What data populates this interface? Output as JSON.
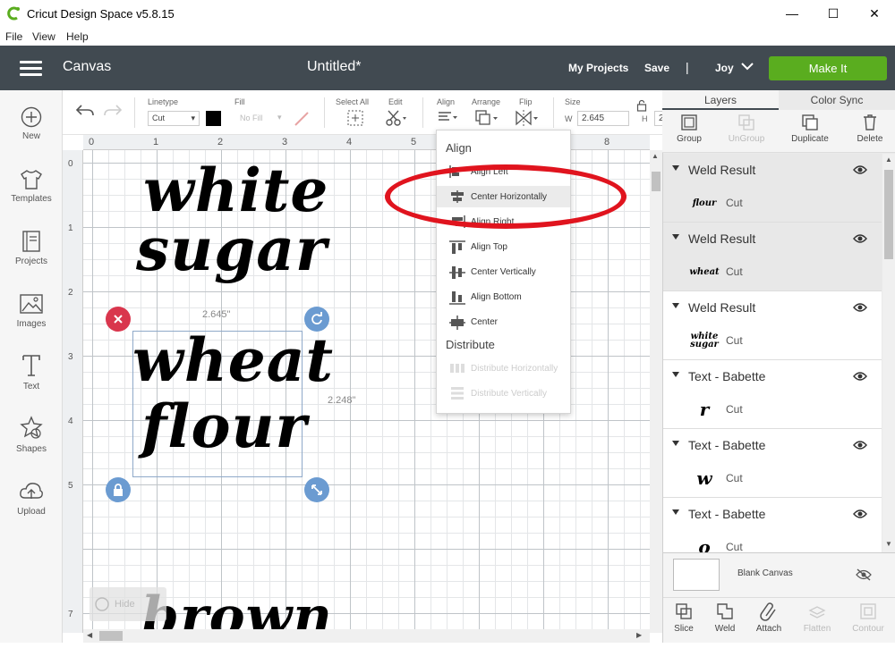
{
  "window": {
    "title": "Cricut Design Space  v5.8.15",
    "minimize": "—",
    "maximize": "☐",
    "close": "✕"
  },
  "menu": [
    "File",
    "View",
    "Help"
  ],
  "header": {
    "canvas": "Canvas",
    "doc_title": "Untitled*",
    "my_projects": "My Projects",
    "save": "Save",
    "separator": "|",
    "user": "Joy",
    "make_it": "Make It"
  },
  "sidebar": [
    {
      "label": "New",
      "icon": "plus-circle-icon"
    },
    {
      "label": "Templates",
      "icon": "tshirt-icon"
    },
    {
      "label": "Projects",
      "icon": "projects-icon"
    },
    {
      "label": "Images",
      "icon": "image-icon"
    },
    {
      "label": "Text",
      "icon": "text-t-icon"
    },
    {
      "label": "Shapes",
      "icon": "shapes-icon"
    },
    {
      "label": "Upload",
      "icon": "cloud-upload-icon"
    }
  ],
  "toolbar": {
    "linetype_label": "Linetype",
    "linetype_value": "Cut",
    "fill_label": "Fill",
    "fill_value": "No Fill",
    "select_all": "Select All",
    "edit": "Edit",
    "align": "Align",
    "arrange": "Arrange",
    "flip": "Flip",
    "size": "Size",
    "w_label": "W",
    "w_value": "2.645",
    "h_label": "H",
    "h_value": "2"
  },
  "ruler": {
    "top": [
      "0",
      "1",
      "2",
      "3",
      "4",
      "5",
      "8"
    ],
    "left": [
      "0",
      "1",
      "2",
      "3",
      "4",
      "5",
      "7"
    ]
  },
  "canvas": {
    "text1_line1": "white",
    "text1_line2": "sugar",
    "text2_line1": "wheat",
    "text2_line2": "flour",
    "text3": "brown",
    "width_label": "2.645\"",
    "height_label": "2.248\"",
    "hide_label": "Hide"
  },
  "align_menu": {
    "align_heading": "Align",
    "items": [
      "Align Left",
      "Center Horizontally",
      "Align Right",
      "Align Top",
      "Center Vertically",
      "Align Bottom",
      "Center"
    ],
    "distribute_heading": "Distribute",
    "distribute_items": [
      "Distribute Horizontally",
      "Distribute Vertically"
    ]
  },
  "right_panel": {
    "tabs": [
      "Layers",
      "Color Sync"
    ],
    "tools": [
      "Group",
      "UnGroup",
      "Duplicate",
      "Delete"
    ],
    "layers": [
      {
        "name": "Weld Result",
        "type": "Cut",
        "thumb": "flour"
      },
      {
        "name": "Weld Result",
        "type": "Cut",
        "thumb": "wheat"
      },
      {
        "name": "Weld Result",
        "type": "Cut",
        "thumb": "white sugar"
      },
      {
        "name": "Text - Babette",
        "type": "Cut",
        "thumb": "r"
      },
      {
        "name": "Text - Babette",
        "type": "Cut",
        "thumb": "w"
      },
      {
        "name": "Text - Babette",
        "type": "Cut",
        "thumb": "o"
      }
    ],
    "blank_canvas": "Blank Canvas",
    "bottom_tools": [
      "Slice",
      "Weld",
      "Attach",
      "Flatten",
      "Contour"
    ]
  },
  "colors": {
    "header_bg": "#414a51",
    "make_it": "#5aad1f",
    "highlight_ring": "#e0141e",
    "delete_handle": "#d9364d",
    "handle_blue": "#6b9bd1"
  }
}
